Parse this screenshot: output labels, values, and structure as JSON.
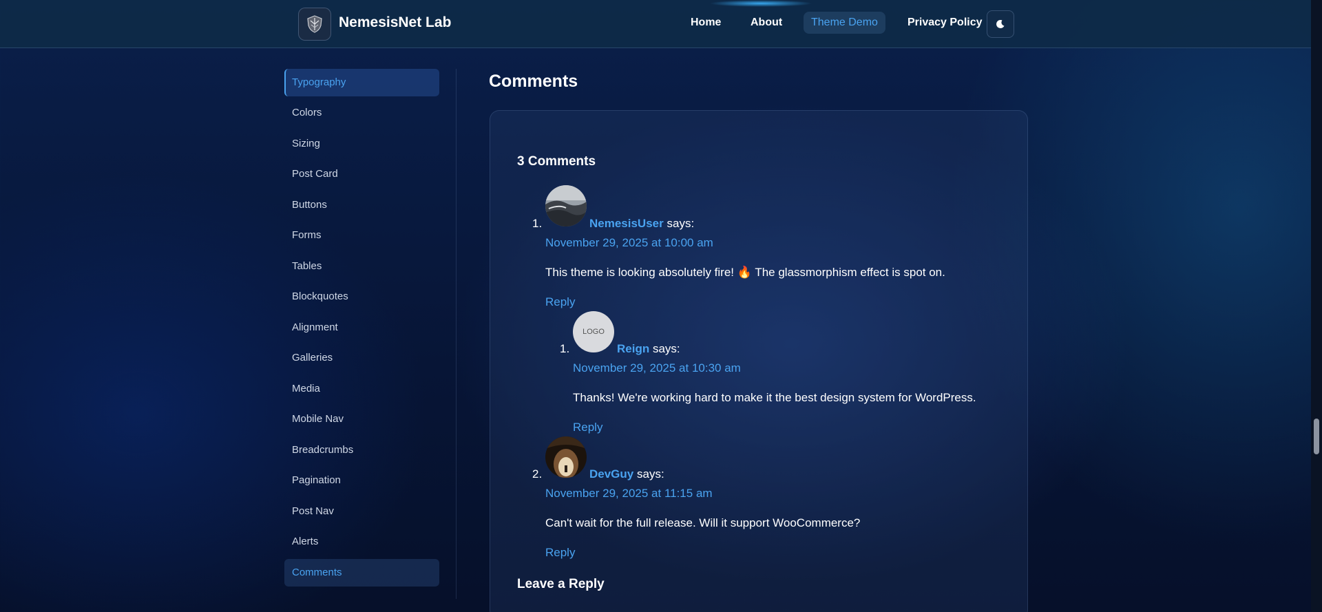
{
  "header": {
    "site_title": "NemesisNet Lab",
    "logo_icon": "shield-logo-icon",
    "nav": [
      "Home",
      "About",
      "Theme Demo",
      "Privacy Policy"
    ],
    "active_nav": "Theme Demo",
    "theme_toggle_icon": "moon-icon"
  },
  "sidebar": {
    "items": [
      "Typography",
      "Colors",
      "Sizing",
      "Post Card",
      "Buttons",
      "Forms",
      "Tables",
      "Blockquotes",
      "Alignment",
      "Galleries",
      "Media",
      "Mobile Nav",
      "Breadcrumbs",
      "Pagination",
      "Post Nav",
      "Alerts",
      "Comments"
    ]
  },
  "main": {
    "title": "Comments",
    "comments_count_heading": "3 Comments",
    "comments": [
      {
        "number": "1.",
        "author": "NemesisUser",
        "says": "says:",
        "date": "November 29, 2025 at 10:00 am",
        "body": "This theme is looking absolutely fire! 🔥 The glassmorphism effect is spot on.",
        "reply": "Reply"
      },
      {
        "number": "1.",
        "author": "Reign",
        "says": "says:",
        "avatar_text": "LOGO",
        "date": "November 29, 2025 at 10:30 am",
        "body": "Thanks! We're working hard to make it the best design system for WordPress.",
        "reply": "Reply"
      },
      {
        "number": "2.",
        "author": "DevGuy",
        "says": "says:",
        "date": "November 29, 2025 at 11:15 am",
        "body": "Can't wait for the full release. Will it support WooCommerce?",
        "reply": "Reply"
      }
    ],
    "leave_reply": "Leave a Reply"
  },
  "colors": {
    "accent": "#4aa3f0",
    "header_bg": "#0e2a48",
    "page_bg": "#071536"
  }
}
